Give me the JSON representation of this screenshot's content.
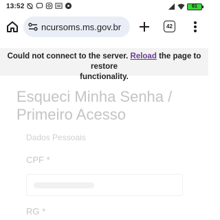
{
  "status_bar": {
    "time": "13:52",
    "battery_level": "61",
    "notification_icons": [
      "alarm-off-icon",
      "chat-icon",
      "instagram-icon",
      "news-icon",
      "flower-icon"
    ]
  },
  "browser": {
    "url": "ncursoms.ms.gov.br",
    "tab_count": "42"
  },
  "notice": {
    "text_before": "Could not connect to the server.",
    "reload_link": "Reload",
    "text_after": "the page to restore",
    "line2": "functionality."
  },
  "form": {
    "title": "Esqueci Minha Senha / Primeiro Acesso",
    "section": "Dados Pessoais",
    "cpf_label": "CPF *",
    "rg_label": "RG *"
  }
}
